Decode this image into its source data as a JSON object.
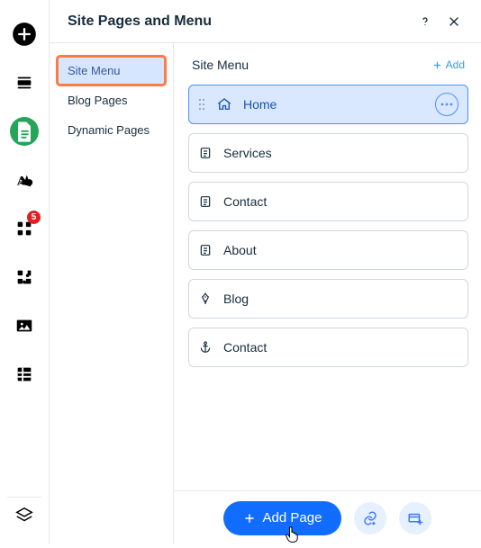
{
  "header": {
    "title": "Site Pages and Menu"
  },
  "sidebar": {
    "items": [
      {
        "label": "Site Menu",
        "active": true,
        "highlighted": true
      },
      {
        "label": "Blog Pages",
        "active": false,
        "highlighted": false
      },
      {
        "label": "Dynamic Pages",
        "active": false,
        "highlighted": false
      }
    ]
  },
  "content": {
    "title": "Site Menu",
    "add_link": "Add",
    "pages": [
      {
        "icon": "home",
        "label": "Home",
        "active": true
      },
      {
        "icon": "page",
        "label": "Services",
        "active": false
      },
      {
        "icon": "page",
        "label": "Contact",
        "active": false
      },
      {
        "icon": "page",
        "label": "About",
        "active": false
      },
      {
        "icon": "pen",
        "label": "Blog",
        "active": false
      },
      {
        "icon": "anchor",
        "label": "Contact",
        "active": false
      }
    ]
  },
  "footer": {
    "add_page": "Add Page"
  },
  "rail": {
    "apps_badge": "5"
  }
}
